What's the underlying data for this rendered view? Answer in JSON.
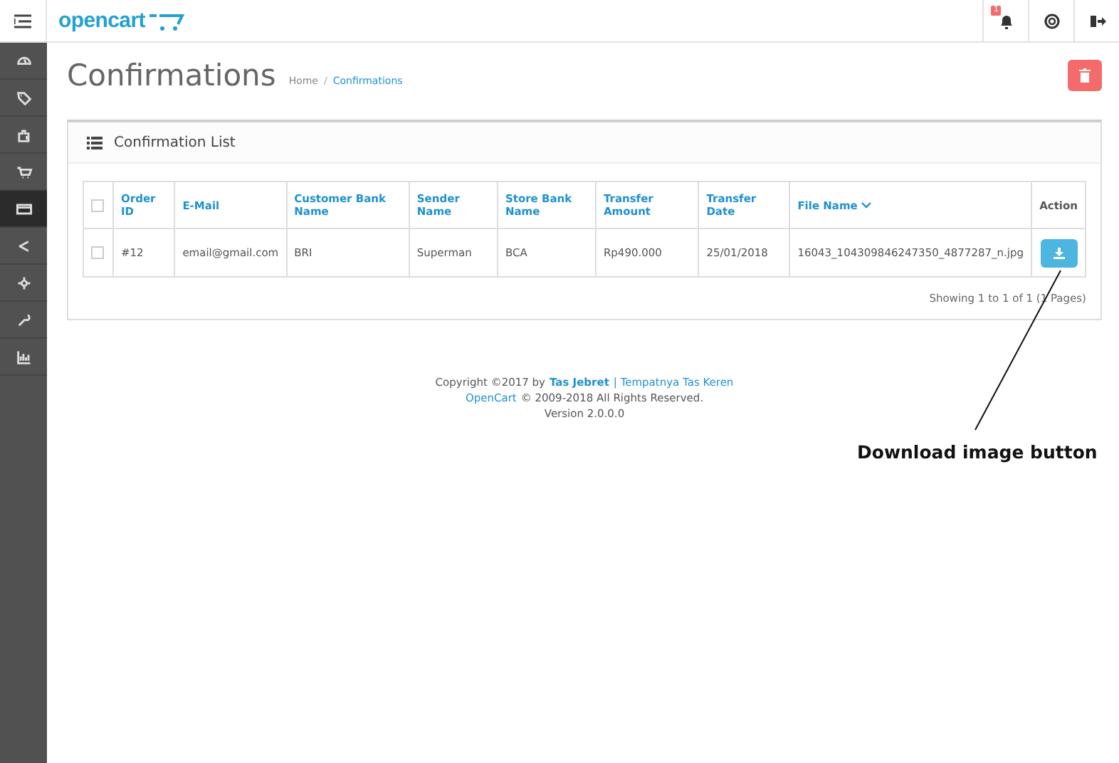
{
  "header": {
    "logo": "opencart",
    "notification_count": "1"
  },
  "sidebar": {
    "items": [
      {
        "selected": false
      },
      {
        "selected": false
      },
      {
        "selected": false
      },
      {
        "selected": false
      },
      {
        "selected": true
      },
      {
        "selected": false
      },
      {
        "selected": false
      },
      {
        "selected": false
      },
      {
        "selected": false
      }
    ]
  },
  "page": {
    "title": "Confirmations",
    "breadcrumb_separator": "/",
    "breadcrumbs": [
      {
        "label": "Home",
        "selected": false
      },
      {
        "label": "Confirmations",
        "selected": true
      }
    ]
  },
  "panel": {
    "title": "Confirmation List",
    "table": {
      "columns": [
        {
          "kind": "check",
          "checked": false
        },
        {
          "kind": "text",
          "label": "Order ID"
        },
        {
          "kind": "text",
          "label": "E-Mail"
        },
        {
          "kind": "text",
          "label": "Customer Bank Name"
        },
        {
          "kind": "text",
          "label": "Sender Name"
        },
        {
          "kind": "text",
          "label": "Store Bank Name"
        },
        {
          "kind": "text",
          "label": "Transfer Amount"
        },
        {
          "kind": "text",
          "label": "Transfer Date"
        },
        {
          "kind": "sorted",
          "label": "File Name"
        },
        {
          "kind": "plain",
          "label": "Action"
        }
      ],
      "rows": [
        {
          "checked": false,
          "cells": [
            "",
            "#12",
            "email@gmail.com",
            "BRI",
            "Superman",
            "BCA",
            "Rp490.000",
            "25/01/2018",
            "16043_104309846247350_4877287_n.jpg",
            ""
          ]
        }
      ]
    },
    "pagination": "Showing 1 to 1 of 1 (1 Pages)"
  },
  "footer": {
    "lines": [
      [
        {
          "kind": "text",
          "text": "Copyright ©2017 by"
        },
        {
          "kind": "bold-link",
          "text": "Tas Jebret"
        },
        {
          "kind": "link",
          "text": "| Tempatnya Tas Keren"
        }
      ],
      [
        {
          "kind": "link",
          "text": "OpenCart"
        },
        {
          "kind": "text",
          "text": "© 2009-2018 All Rights Reserved."
        }
      ],
      [
        {
          "kind": "text",
          "text": "Version 2.0.0.0"
        }
      ]
    ]
  },
  "annotation": {
    "text": "Download image button"
  }
}
